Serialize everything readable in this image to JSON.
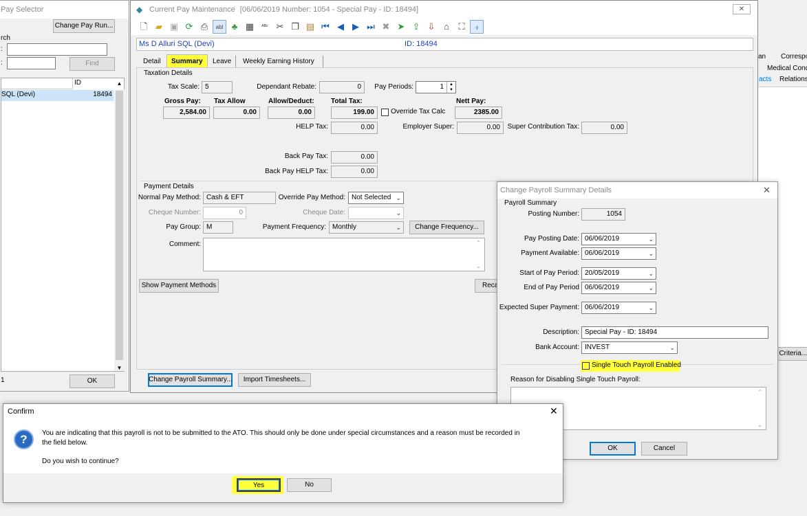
{
  "pay_selector": {
    "title": "Pay Selector",
    "change_pay_run_button": "Change Pay Run...",
    "search_label": "rch",
    "field_label_1": ":",
    "field_label_2": ":",
    "find_button": "Find",
    "col_id_header": "ID",
    "row_name": "SQL  (Devi)",
    "row_id": "18494",
    "count": "1",
    "ok_button": "OK"
  },
  "right_bg": {
    "tab_an": "an",
    "tab_corresp": "Correspo",
    "tab_medical": "Medical Condi",
    "tab_acts": "acts",
    "tab_relations": "Relations",
    "criteria_button": "Criteria..."
  },
  "main_window": {
    "title": "Current Pay Maintenance",
    "title_detail": "[06/06/2019  Number: 1054 - Special Pay - ID: 18494]",
    "close_glyph": "✕",
    "employee_name": "Ms D Alluri SQL  (Devi)",
    "employee_id": "ID: 18494",
    "tabs": [
      "Detail",
      "Summary",
      "Leave",
      "Weekly Earning History"
    ],
    "taxation_group": "Taxation Details",
    "tax_scale_label": "Tax Scale:",
    "tax_scale_value": "5",
    "dependant_rebate_label": "Dependant Rebate:",
    "dependant_rebate_value": "0",
    "pay_periods_label": "Pay Periods:",
    "pay_periods_value": "1",
    "gross_pay_label": "Gross Pay:",
    "gross_pay_value": "2,584.00",
    "tax_allow_label": "Tax Allow",
    "tax_allow_value": "0.00",
    "allow_deduct_label": "Allow/Deduct:",
    "allow_deduct_value": "0.00",
    "total_tax_label": "Total Tax:",
    "total_tax_value": "199.00",
    "override_tax_calc_label": "Override Tax Calc",
    "nett_pay_label": "Nett Pay:",
    "nett_pay_value": "2385.00",
    "help_tax_label": "HELP Tax:",
    "help_tax_value": "0.00",
    "employer_super_label": "Employer Super:",
    "employer_super_value": "0.00",
    "super_contrib_tax_label": "Super Contribution Tax:",
    "super_contrib_tax_value": "0.00",
    "back_pay_tax_label": "Back Pay Tax:",
    "back_pay_tax_value": "0.00",
    "back_pay_help_tax_label": "Back Pay HELP Tax:",
    "back_pay_help_tax_value": "0.00",
    "payment_group": "Payment Details",
    "normal_pay_method_label": "Normal Pay Method:",
    "normal_pay_method_value": "Cash & EFT",
    "override_pay_method_label": "Override Pay Method:",
    "override_pay_method_value": "Not Selected",
    "cheque_number_label": "Cheque Number:",
    "cheque_number_value": "0",
    "cheque_date_label": "Cheque Date:",
    "cheque_date_value": "",
    "pay_group_label": "Pay Group:",
    "pay_group_value": "M",
    "payment_frequency_label": "Payment Frequency:",
    "payment_frequency_value": "Monthly",
    "change_frequency_button": "Change Frequency...",
    "comment_label": "Comment:",
    "show_payment_methods_button": "Show Payment Methods",
    "recalc_button": "Recal",
    "change_payroll_summary_button": "Change Payroll Summary...",
    "import_timesheets_button": "Import Timesheets..."
  },
  "payroll_summary_dialog": {
    "title": "Change Payroll Summary Details",
    "group_label": "Payroll Summary",
    "posting_number_label": "Posting Number:",
    "posting_number_value": "1054",
    "pay_posting_date_label": "Pay Posting Date:",
    "pay_posting_date_value": "06/06/2019",
    "payment_available_label": "Payment Available:",
    "payment_available_value": "06/06/2019",
    "start_of_pay_period_label": "Start of Pay Period:",
    "start_of_pay_period_value": "20/05/2019",
    "end_of_pay_period_label": "End of Pay Period",
    "end_of_pay_period_value": "06/06/2019",
    "expected_super_payment_label": "Expected Super Payment:",
    "expected_super_payment_value": "06/06/2019",
    "description_label": "Description:",
    "description_value": "Special Pay - ID: 18494",
    "bank_account_label": "Bank Account:",
    "bank_account_value": "INVEST",
    "stp_enabled_label": "Single Touch Payroll Enabled",
    "stp_enabled_checked": false,
    "reason_label": "Reason for Disabling Single Touch Payroll:",
    "ok_button": "OK",
    "cancel_button": "Cancel"
  },
  "confirm_dialog": {
    "title": "Confirm",
    "message_line1": "You are indicating that this payroll is not to be submitted to the ATO.  This should only be done under special circumstances and a reason must be recorded in",
    "message_line2": "the field below.",
    "question": "Do you wish to continue?",
    "yes_button": "Yes",
    "no_button": "No"
  },
  "colors": {
    "highlight": "#ffff3c",
    "focus_blue": "#0078d7",
    "id_text_blue": "#1a3fbf"
  }
}
